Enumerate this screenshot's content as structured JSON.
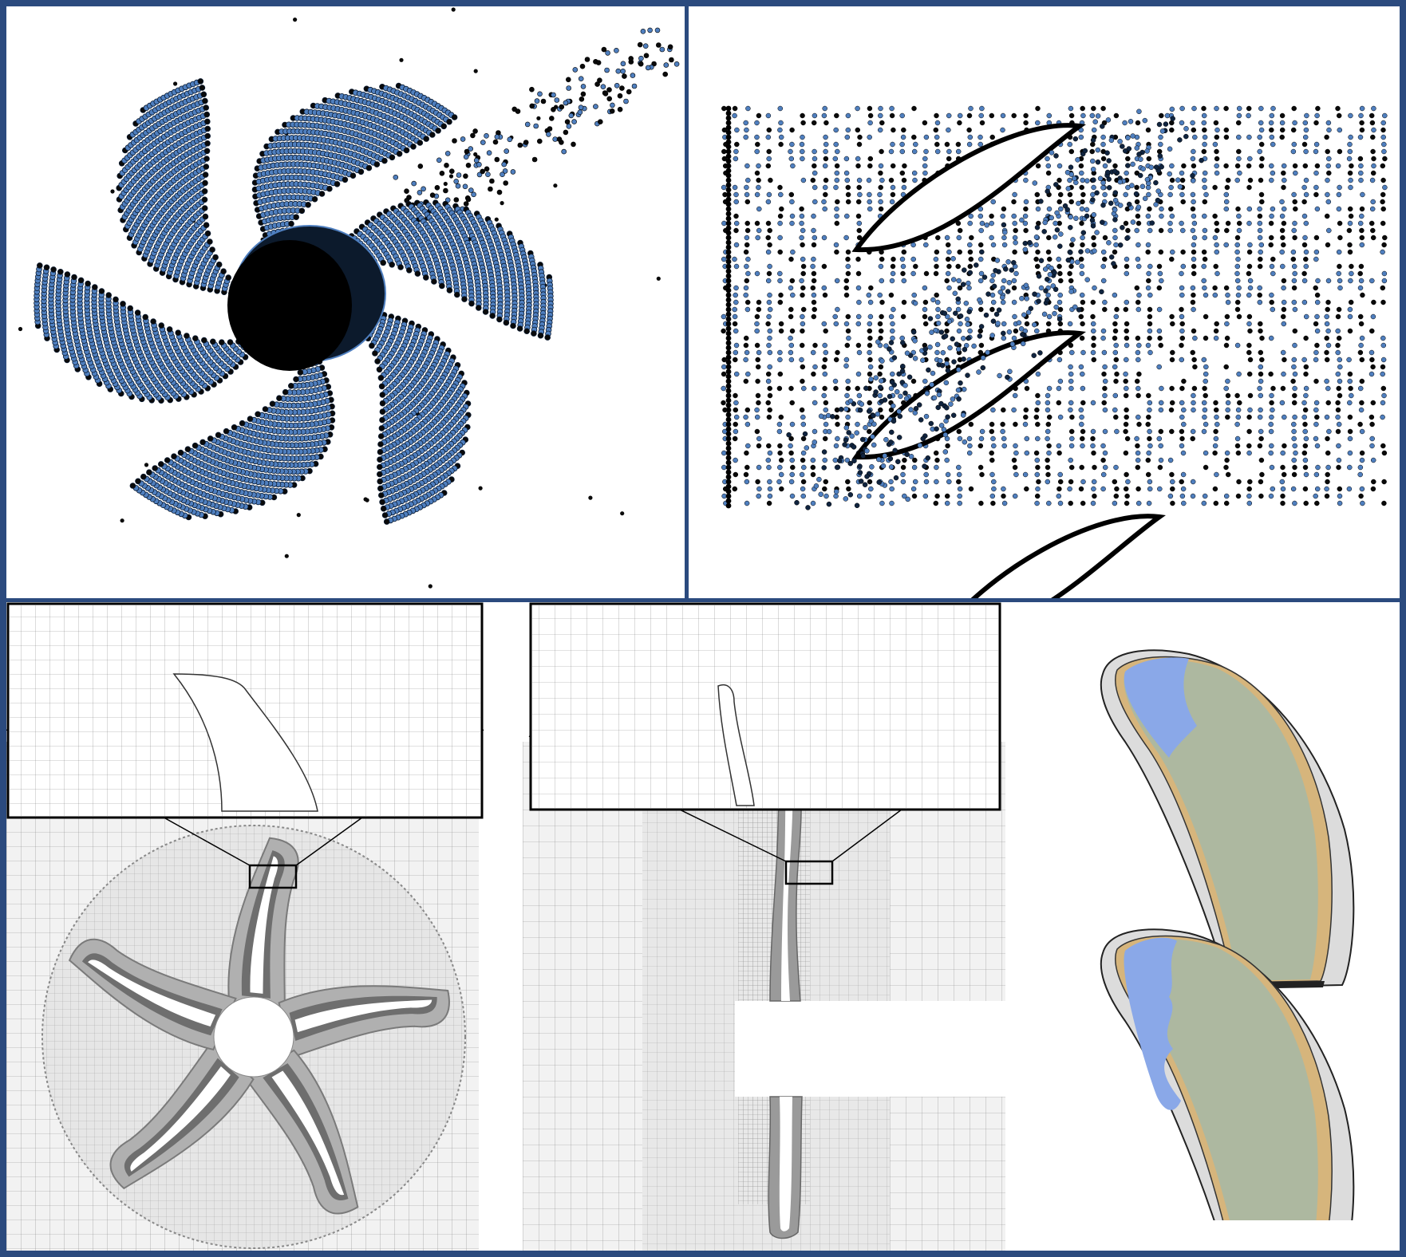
{
  "colors": {
    "frame_border": "#2b4a7e",
    "particle_blue": "#4f7fbf",
    "particle_dark": "#0a0a0a",
    "mesh_fill": "#efefef",
    "mesh_line": "#9a9a9a",
    "blade_grey": "#c8ccc6",
    "blade_green": "#a8b49a",
    "blade_blue": "#7f9fe0",
    "blade_tan": "#d6b57c"
  },
  "icons": {
    "propeller_particles": "propeller-particle-cloud",
    "cascade_particles": "blade-cascade-particle-cloud",
    "radial_mesh": "radial-adaptive-mesh",
    "axial_mesh": "axial-adaptive-mesh",
    "blade_surfaces": "blade-surface-render"
  },
  "panels": {
    "particles_3d": {
      "blades": 6
    },
    "cascade": {
      "visible_blades": 3
    },
    "mesh_radial": {
      "blades": 5
    },
    "mesh_axial": {
      "blades": 1
    },
    "blade_renders": {
      "count": 2
    }
  }
}
